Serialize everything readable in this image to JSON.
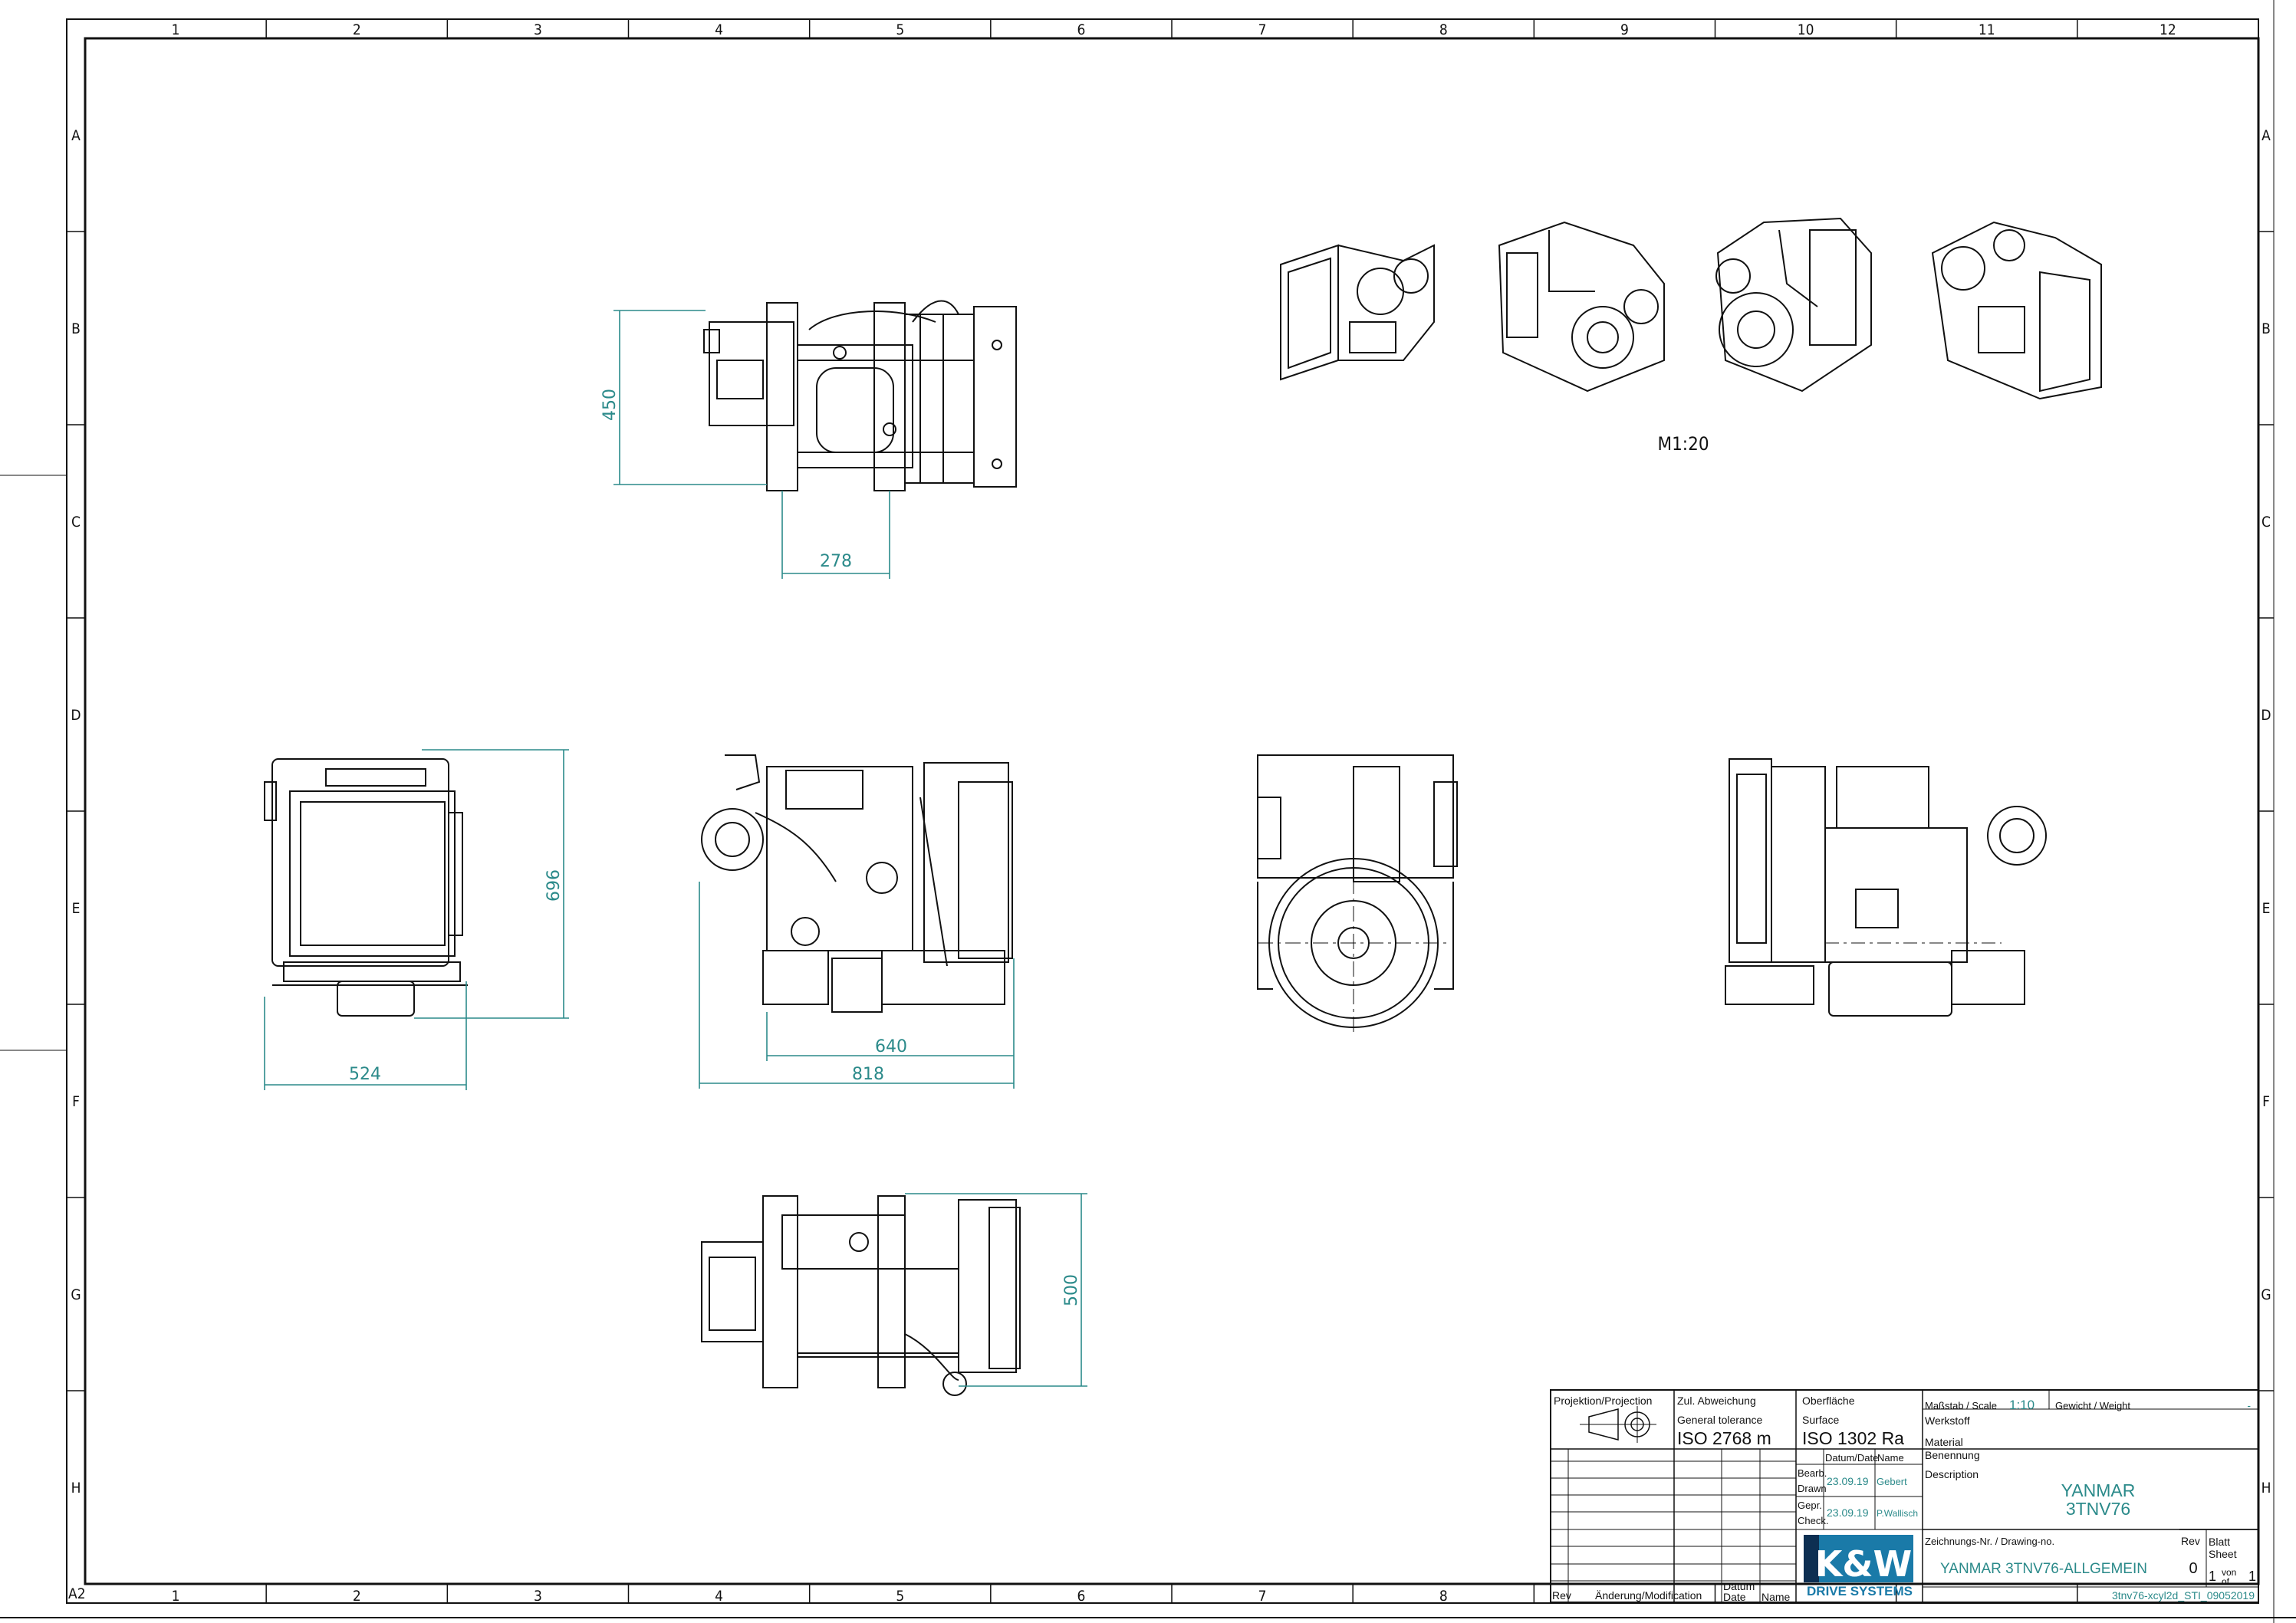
{
  "border": {
    "columns": [
      "1",
      "2",
      "3",
      "4",
      "5",
      "6",
      "7",
      "8",
      "9",
      "10",
      "11",
      "12"
    ],
    "rows": [
      "A",
      "B",
      "C",
      "D",
      "E",
      "F",
      "G",
      "H"
    ],
    "format": "A2"
  },
  "views": {
    "iso_scale_label": "M1:20"
  },
  "dimensions": {
    "top_height": "450",
    "top_width": "278",
    "front_height": "696",
    "front_width": "524",
    "side_inner_width": "640",
    "side_overall_width": "818",
    "bottom_height": "500"
  },
  "title_block": {
    "projection_label": "Projektion/Projection",
    "tolerance_label_de": "Zul. Abweichung",
    "tolerance_label_en": "General tolerance",
    "tolerance_value": "ISO 2768 m",
    "surface_label_de": "Oberfläche",
    "surface_label_en": "Surface",
    "surface_value": "ISO 1302 Ra",
    "scale_label": "Maßstab / Scale",
    "scale_value": "1:10",
    "weight_label": "Gewicht / Weight",
    "weight_value": "-",
    "material_label_de": "Werkstoff",
    "material_label_en": "Material",
    "description_label_de": "Benennung",
    "description_label_en": "Description",
    "description_line1": "YANMAR",
    "description_line2": "3TNV76",
    "date_name_header": "Datum/Date",
    "name_header": "Name",
    "drawn_label_de": "Bearb.",
    "drawn_label_en": "Drawn",
    "drawn_date": "23.09.19",
    "drawn_name": "Gebert",
    "checked_label_de": "Gepr.",
    "checked_label_en": "Check.",
    "checked_date": "23.09.19",
    "checked_name": "P.Wallisch",
    "drawing_no_label": "Zeichnungs-Nr. / Drawing-no.",
    "drawing_no": "YANMAR 3TNV76-ALLGEMEIN",
    "rev_label": "Rev",
    "rev_value": "0",
    "sheet_label_de": "Blatt",
    "sheet_label_en": "Sheet",
    "sheet_current": "1",
    "sheet_of_de": "von",
    "sheet_of_en": "of",
    "sheet_total": "1",
    "file_name": "3tnv76-xcyl2d_STI_09052019",
    "rev_col": "Rev",
    "modification_col": "Änderung/Modification",
    "date_col_de": "Datum",
    "date_col_en": "Date",
    "name_col": "Name",
    "logo_text": "K&W",
    "logo_subtitle": "DRIVE SYSTEMS"
  }
}
